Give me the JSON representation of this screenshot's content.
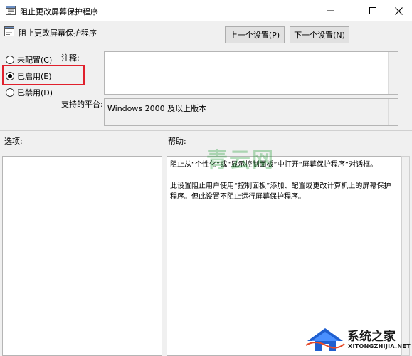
{
  "window": {
    "title": "阻止更改屏幕保护程序",
    "app_icon": "policy-icon",
    "buttons": [
      "minimize-icon",
      "maximize-icon",
      "close-icon"
    ]
  },
  "header": {
    "title": "阻止更改屏幕保护程序",
    "icon": "policy-icon",
    "prev_label": "上一个设置(P)",
    "next_label": "下一个设置(N)"
  },
  "state": {
    "options": [
      {
        "label": "未配置(C)",
        "selected": false
      },
      {
        "label": "已启用(E)",
        "selected": true
      },
      {
        "label": "已禁用(D)",
        "selected": false
      }
    ]
  },
  "fields": {
    "note_label": "注释:",
    "note_value": "",
    "platform_label": "支持的平台:",
    "platform_value": "Windows 2000 及以上版本"
  },
  "panes": {
    "options_label": "选项:",
    "help_label": "帮助:",
    "help_paragraphs": [
      "阻止从“个性化”或“显示控制面板”中打开“屏幕保护程序”对话框。",
      "此设置阻止用户使用“控制面板”添加、配置或更改计算机上的屏幕保护程序。但此设置不阻止运行屏幕保护程序。"
    ]
  },
  "overlays": {
    "watermark_text": "青云网",
    "brand_name": "系统之家",
    "brand_url": "XITONGZHIJIA.NET",
    "highlight_color": "#e0202c",
    "watermark_color": "#28a03c"
  }
}
